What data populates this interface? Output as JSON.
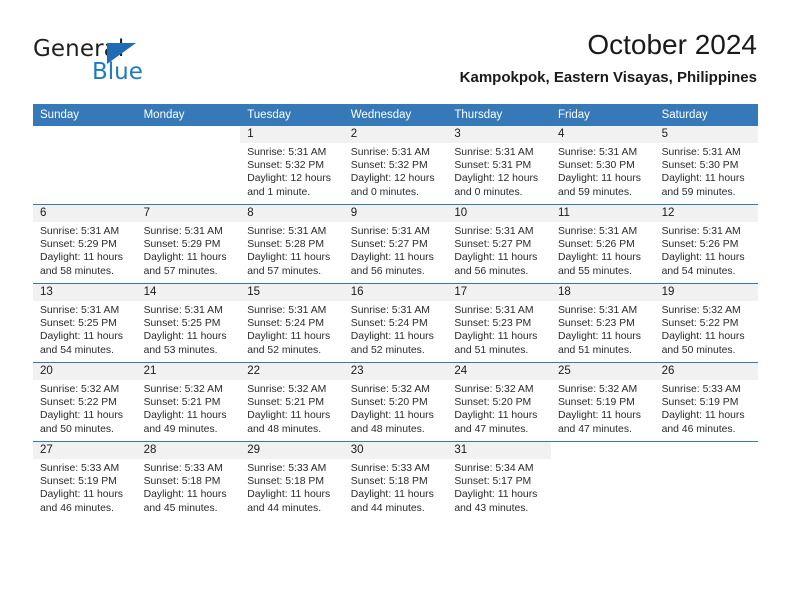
{
  "brand": {
    "name_top": "General",
    "name_bottom": "Blue",
    "accent_color": "#1f7ac4",
    "triangle_color": "#1f6cb6"
  },
  "header": {
    "title": "October 2024",
    "subtitle": "Kampokpok, Eastern Visayas, Philippines"
  },
  "calendar": {
    "header_bg": "#3679b9",
    "daynum_band_bg": "#f1f1f1",
    "weekday_headers": [
      "Sunday",
      "Monday",
      "Tuesday",
      "Wednesday",
      "Thursday",
      "Friday",
      "Saturday"
    ],
    "weeks": [
      [
        {
          "day": "",
          "sunrise": "",
          "sunset": "",
          "daylight_a": "",
          "daylight_b": ""
        },
        {
          "day": "",
          "sunrise": "",
          "sunset": "",
          "daylight_a": "",
          "daylight_b": ""
        },
        {
          "day": "1",
          "sunrise": "Sunrise: 5:31 AM",
          "sunset": "Sunset: 5:32 PM",
          "daylight_a": "Daylight: 12 hours",
          "daylight_b": "and 1 minute."
        },
        {
          "day": "2",
          "sunrise": "Sunrise: 5:31 AM",
          "sunset": "Sunset: 5:32 PM",
          "daylight_a": "Daylight: 12 hours",
          "daylight_b": "and 0 minutes."
        },
        {
          "day": "3",
          "sunrise": "Sunrise: 5:31 AM",
          "sunset": "Sunset: 5:31 PM",
          "daylight_a": "Daylight: 12 hours",
          "daylight_b": "and 0 minutes."
        },
        {
          "day": "4",
          "sunrise": "Sunrise: 5:31 AM",
          "sunset": "Sunset: 5:30 PM",
          "daylight_a": "Daylight: 11 hours",
          "daylight_b": "and 59 minutes."
        },
        {
          "day": "5",
          "sunrise": "Sunrise: 5:31 AM",
          "sunset": "Sunset: 5:30 PM",
          "daylight_a": "Daylight: 11 hours",
          "daylight_b": "and 59 minutes."
        }
      ],
      [
        {
          "day": "6",
          "sunrise": "Sunrise: 5:31 AM",
          "sunset": "Sunset: 5:29 PM",
          "daylight_a": "Daylight: 11 hours",
          "daylight_b": "and 58 minutes."
        },
        {
          "day": "7",
          "sunrise": "Sunrise: 5:31 AM",
          "sunset": "Sunset: 5:29 PM",
          "daylight_a": "Daylight: 11 hours",
          "daylight_b": "and 57 minutes."
        },
        {
          "day": "8",
          "sunrise": "Sunrise: 5:31 AM",
          "sunset": "Sunset: 5:28 PM",
          "daylight_a": "Daylight: 11 hours",
          "daylight_b": "and 57 minutes."
        },
        {
          "day": "9",
          "sunrise": "Sunrise: 5:31 AM",
          "sunset": "Sunset: 5:27 PM",
          "daylight_a": "Daylight: 11 hours",
          "daylight_b": "and 56 minutes."
        },
        {
          "day": "10",
          "sunrise": "Sunrise: 5:31 AM",
          "sunset": "Sunset: 5:27 PM",
          "daylight_a": "Daylight: 11 hours",
          "daylight_b": "and 56 minutes."
        },
        {
          "day": "11",
          "sunrise": "Sunrise: 5:31 AM",
          "sunset": "Sunset: 5:26 PM",
          "daylight_a": "Daylight: 11 hours",
          "daylight_b": "and 55 minutes."
        },
        {
          "day": "12",
          "sunrise": "Sunrise: 5:31 AM",
          "sunset": "Sunset: 5:26 PM",
          "daylight_a": "Daylight: 11 hours",
          "daylight_b": "and 54 minutes."
        }
      ],
      [
        {
          "day": "13",
          "sunrise": "Sunrise: 5:31 AM",
          "sunset": "Sunset: 5:25 PM",
          "daylight_a": "Daylight: 11 hours",
          "daylight_b": "and 54 minutes."
        },
        {
          "day": "14",
          "sunrise": "Sunrise: 5:31 AM",
          "sunset": "Sunset: 5:25 PM",
          "daylight_a": "Daylight: 11 hours",
          "daylight_b": "and 53 minutes."
        },
        {
          "day": "15",
          "sunrise": "Sunrise: 5:31 AM",
          "sunset": "Sunset: 5:24 PM",
          "daylight_a": "Daylight: 11 hours",
          "daylight_b": "and 52 minutes."
        },
        {
          "day": "16",
          "sunrise": "Sunrise: 5:31 AM",
          "sunset": "Sunset: 5:24 PM",
          "daylight_a": "Daylight: 11 hours",
          "daylight_b": "and 52 minutes."
        },
        {
          "day": "17",
          "sunrise": "Sunrise: 5:31 AM",
          "sunset": "Sunset: 5:23 PM",
          "daylight_a": "Daylight: 11 hours",
          "daylight_b": "and 51 minutes."
        },
        {
          "day": "18",
          "sunrise": "Sunrise: 5:31 AM",
          "sunset": "Sunset: 5:23 PM",
          "daylight_a": "Daylight: 11 hours",
          "daylight_b": "and 51 minutes."
        },
        {
          "day": "19",
          "sunrise": "Sunrise: 5:32 AM",
          "sunset": "Sunset: 5:22 PM",
          "daylight_a": "Daylight: 11 hours",
          "daylight_b": "and 50 minutes."
        }
      ],
      [
        {
          "day": "20",
          "sunrise": "Sunrise: 5:32 AM",
          "sunset": "Sunset: 5:22 PM",
          "daylight_a": "Daylight: 11 hours",
          "daylight_b": "and 50 minutes."
        },
        {
          "day": "21",
          "sunrise": "Sunrise: 5:32 AM",
          "sunset": "Sunset: 5:21 PM",
          "daylight_a": "Daylight: 11 hours",
          "daylight_b": "and 49 minutes."
        },
        {
          "day": "22",
          "sunrise": "Sunrise: 5:32 AM",
          "sunset": "Sunset: 5:21 PM",
          "daylight_a": "Daylight: 11 hours",
          "daylight_b": "and 48 minutes."
        },
        {
          "day": "23",
          "sunrise": "Sunrise: 5:32 AM",
          "sunset": "Sunset: 5:20 PM",
          "daylight_a": "Daylight: 11 hours",
          "daylight_b": "and 48 minutes."
        },
        {
          "day": "24",
          "sunrise": "Sunrise: 5:32 AM",
          "sunset": "Sunset: 5:20 PM",
          "daylight_a": "Daylight: 11 hours",
          "daylight_b": "and 47 minutes."
        },
        {
          "day": "25",
          "sunrise": "Sunrise: 5:32 AM",
          "sunset": "Sunset: 5:19 PM",
          "daylight_a": "Daylight: 11 hours",
          "daylight_b": "and 47 minutes."
        },
        {
          "day": "26",
          "sunrise": "Sunrise: 5:33 AM",
          "sunset": "Sunset: 5:19 PM",
          "daylight_a": "Daylight: 11 hours",
          "daylight_b": "and 46 minutes."
        }
      ],
      [
        {
          "day": "27",
          "sunrise": "Sunrise: 5:33 AM",
          "sunset": "Sunset: 5:19 PM",
          "daylight_a": "Daylight: 11 hours",
          "daylight_b": "and 46 minutes."
        },
        {
          "day": "28",
          "sunrise": "Sunrise: 5:33 AM",
          "sunset": "Sunset: 5:18 PM",
          "daylight_a": "Daylight: 11 hours",
          "daylight_b": "and 45 minutes."
        },
        {
          "day": "29",
          "sunrise": "Sunrise: 5:33 AM",
          "sunset": "Sunset: 5:18 PM",
          "daylight_a": "Daylight: 11 hours",
          "daylight_b": "and 44 minutes."
        },
        {
          "day": "30",
          "sunrise": "Sunrise: 5:33 AM",
          "sunset": "Sunset: 5:18 PM",
          "daylight_a": "Daylight: 11 hours",
          "daylight_b": "and 44 minutes."
        },
        {
          "day": "31",
          "sunrise": "Sunrise: 5:34 AM",
          "sunset": "Sunset: 5:17 PM",
          "daylight_a": "Daylight: 11 hours",
          "daylight_b": "and 43 minutes."
        },
        {
          "day": "",
          "sunrise": "",
          "sunset": "",
          "daylight_a": "",
          "daylight_b": ""
        },
        {
          "day": "",
          "sunrise": "",
          "sunset": "",
          "daylight_a": "",
          "daylight_b": ""
        }
      ]
    ]
  }
}
